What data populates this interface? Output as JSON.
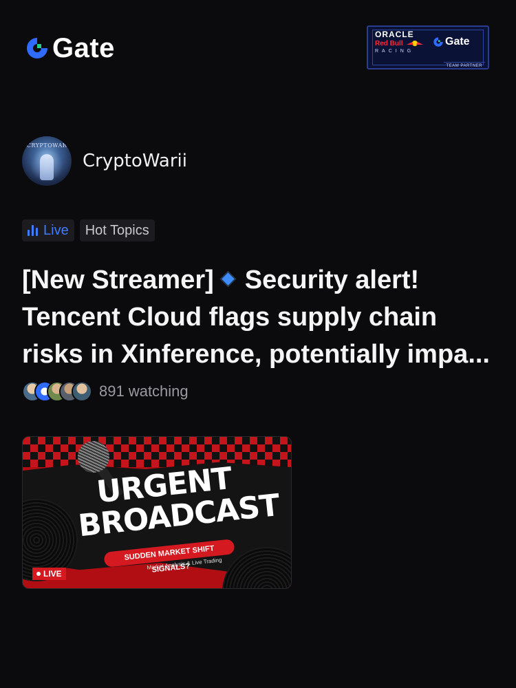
{
  "header": {
    "logo_text": "Gate",
    "partner": {
      "oracle": "ORACLE",
      "redbull": "Red Bull",
      "racing": "RACING",
      "gate": "Gate",
      "team_partner": "TEAM PARTNER"
    }
  },
  "streamer": {
    "name": "CryptoWarii",
    "avatar_text": "CRYPTOWAR"
  },
  "tags": {
    "live": "Live",
    "hot_topics": "Hot Topics"
  },
  "post": {
    "title_part1": "[New Streamer]",
    "title_part2": "Security alert! Tencent Cloud flags supply chain risks in Xinference, potentially impa...",
    "watching": "891 watching"
  },
  "thumbnail": {
    "headline_line1": "URGENT",
    "headline_line2": "BROADCAST",
    "subhead": "SUDDEN MARKET SHIFT SIGNALS?",
    "subtext": "Market Analysis & Live Trading",
    "live_badge": "LIVE"
  },
  "colors": {
    "accent_blue": "#3f7cff",
    "background": "#0b0b0d",
    "live_red": "#d41920"
  },
  "icons": {
    "logo": "gate-logo-icon",
    "live": "live-bars-icon",
    "diamond": "blue-diamond-icon"
  }
}
